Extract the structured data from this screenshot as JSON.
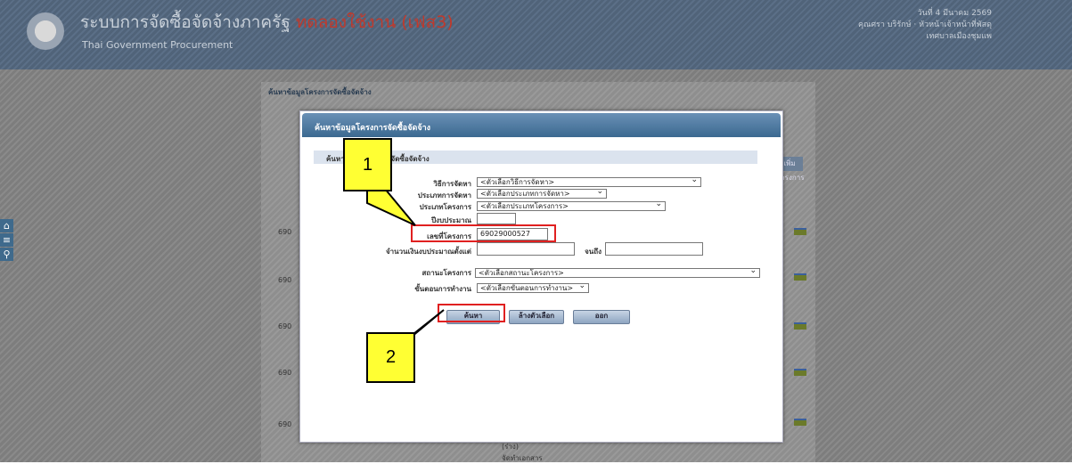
{
  "header": {
    "system_title": "ระบบการจัดซื้อจัดจ้างภาครัฐ",
    "environment": "ทดลองใช้งาน (เฟส3)",
    "subtitle": "Thai Government Procurement",
    "date_text": "วันที่ 4 มีนาคม 2569",
    "user_text": "คุณศรา บริรักษ์ · หัวหน้าเจ้าหน้าที่พัสดุ",
    "org_text": "เทศบาลเมืองชุมแพ"
  },
  "sidetools": [
    {
      "icon": "home-icon",
      "glyph": "⌂"
    },
    {
      "icon": "menu-icon",
      "glyph": "≡"
    },
    {
      "icon": "search-icon",
      "glyph": "⚲"
    }
  ],
  "page": {
    "title": "ค้นหาข้อมูลโครงการจัดซื้อจัดจ้าง",
    "side_button": "เพิ่มโครงการ",
    "row_prefix": "690",
    "footer_line1": "(ร่าง)",
    "footer_line2": "จัดทำเอกสาร"
  },
  "modal": {
    "title": "ค้นหาข้อมูลโครงการจัดซื้อจัดจ้าง",
    "section_title": "ค้นหาข้อมูลโครงการจัดซื้อจัดจ้าง",
    "fields": {
      "method_label": "วิธีการจัดหา",
      "method_value": "<ตัวเลือกวิธีการจัดหา>",
      "proc_type_label": "ประเภทการจัดหา",
      "proc_type_value": "<ตัวเลือกประเภทการจัดหา>",
      "project_type_label": "ประเภทโครงการ",
      "project_type_value": "<ตัวเลือกประเภทโครงการ>",
      "budget_year_label": "ปีงบประมาณ",
      "budget_year_value": "",
      "project_no_label": "เลขที่โครงการ",
      "project_no_value": "69029000527",
      "amount_label": "จำนวนเงินงบประมาณตั้งแต่",
      "amount_from": "",
      "amount_to_label": "จนถึง",
      "amount_to": "",
      "status_label": "สถานะโครงการ",
      "status_value": "<ตัวเลือกสถานะโครงการ>",
      "step_label": "ขั้นตอนการทำงาน",
      "step_value": "<ตัวเลือกขั้นตอนการทำงาน>"
    },
    "buttons": {
      "search": "ค้นหา",
      "clear": "ล้างตัวเลือก",
      "exit": "ออก"
    }
  },
  "annotations": {
    "callout1": "1",
    "callout2": "2",
    "highlight_color": "#e02020",
    "callout_color": "#ffff33"
  }
}
